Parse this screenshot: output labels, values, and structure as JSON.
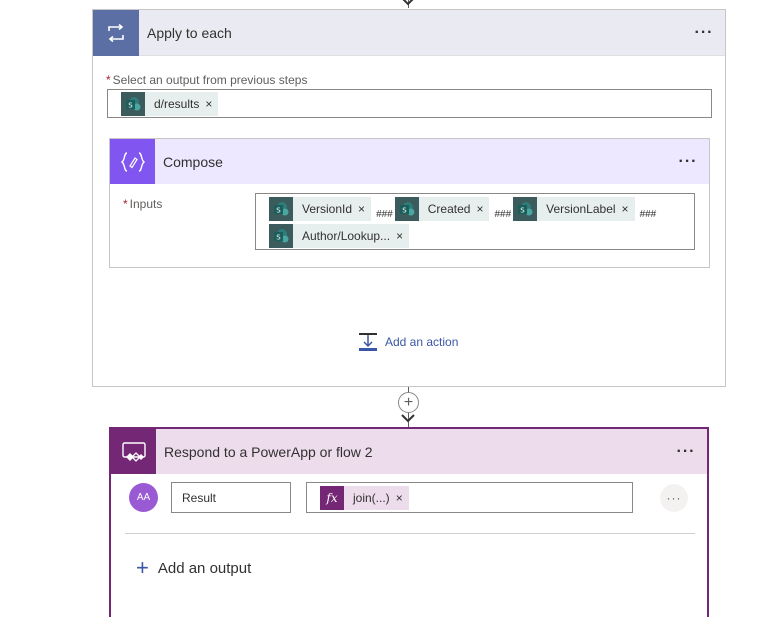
{
  "apply_each": {
    "title": "Apply to each",
    "more": "···",
    "select_label": "Select an output from previous steps",
    "required_mark": "*",
    "output_token": "d/results",
    "token_remove": "×"
  },
  "compose": {
    "title": "Compose",
    "more": "···",
    "inputs_label": "Inputs",
    "required_mark": "*",
    "tokens": [
      "VersionId",
      "Created",
      "VersionLabel",
      "Author/Lookup..."
    ],
    "separator": "###",
    "token_remove": "×"
  },
  "add_action": "Add an action",
  "plus_connector": "+",
  "respond": {
    "title": "Respond to a PowerApp or flow 2",
    "more": "···",
    "avatar_text": "AA",
    "output_name": "Result",
    "fx_token": "join(...)",
    "fx_icon": "fx",
    "token_remove": "×",
    "row_more": "···",
    "add_output_plus": "+",
    "add_output": "Add an output"
  },
  "colors": {
    "apply_accent": "#5b6fa5",
    "compose_accent": "#8055f0",
    "respond_accent": "#742774",
    "sharepoint_token": "#3b5b5c",
    "link_blue": "#3a56a6"
  },
  "icons": {
    "apply": "loop-icon",
    "compose": "compose-braces-icon",
    "respond": "powerapps-icon",
    "token": "sharepoint-icon",
    "add_action": "add-action-icon"
  }
}
